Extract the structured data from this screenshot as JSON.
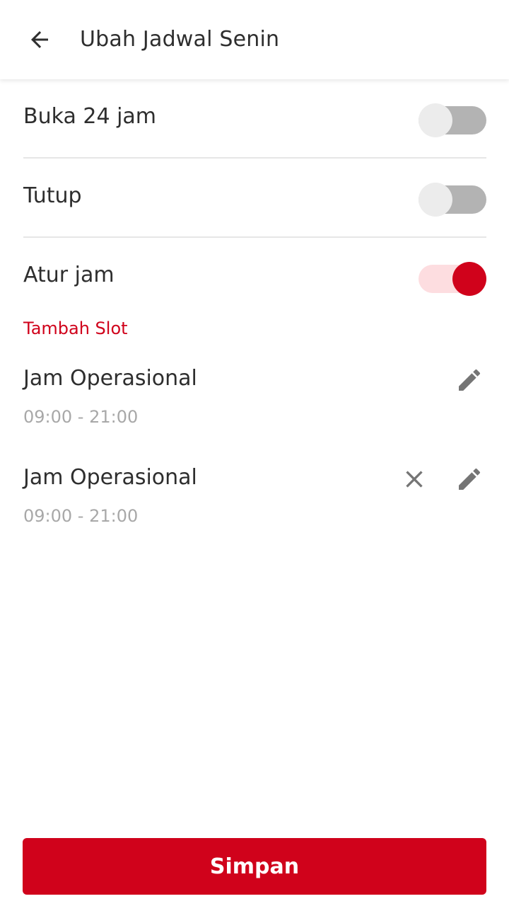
{
  "header": {
    "title": "Ubah Jadwal Senin",
    "back_icon": "arrow-left-icon"
  },
  "options": [
    {
      "label": "Buka 24 jam",
      "enabled": false
    },
    {
      "label": "Tutup",
      "enabled": false
    },
    {
      "label": "Atur jam",
      "enabled": true
    }
  ],
  "add_slot_label": "Tambah Slot",
  "slots": [
    {
      "title": "Jam Operasional",
      "time": "09:00 - 21:00",
      "icons": [
        "pencil-icon"
      ]
    },
    {
      "title": "Jam Operasional",
      "time": "09:00 - 21:00",
      "icons": [
        "close-icon",
        "pencil-icon"
      ]
    }
  ],
  "save_label": "Simpan",
  "colors": {
    "accent": "#d0021b",
    "toggle_on_track": "#fddde0",
    "toggle_off_track": "#b3b3b3",
    "toggle_off_thumb": "#ececec",
    "secondary_text": "#a8a8a8",
    "icon": "#757575"
  }
}
